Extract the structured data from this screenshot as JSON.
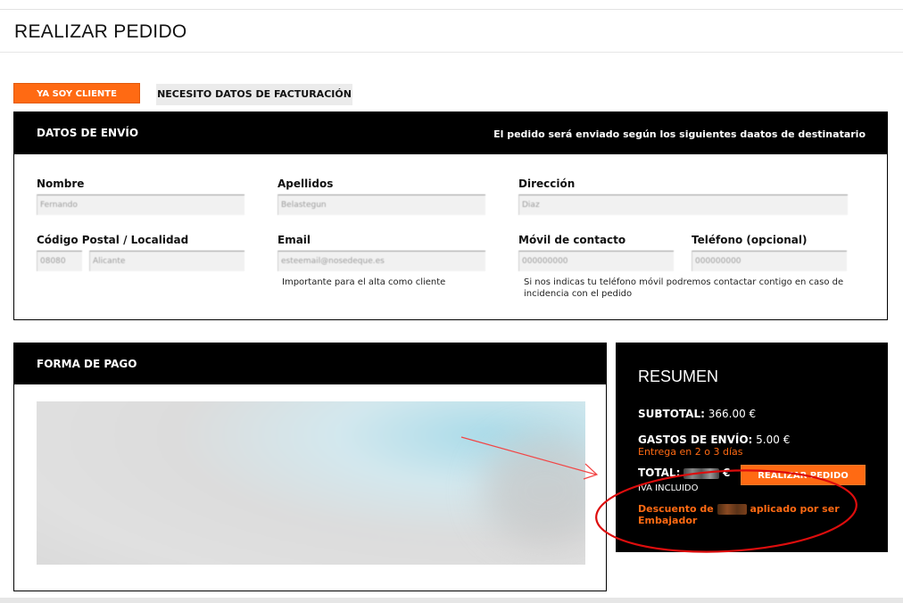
{
  "header": {
    "title": "REALIZAR PEDIDO"
  },
  "tabs": {
    "existing_customer": "YA SOY CLIENTE",
    "billing_data": "NECESITO DATOS DE FACTURACIÓN"
  },
  "shipping": {
    "heading": "DATOS DE ENVÍO",
    "note": "El pedido será enviado según los siguientes daatos de destinatario",
    "fields": {
      "nombre": {
        "label": "Nombre",
        "value": "Fernando"
      },
      "apellidos": {
        "label": "Apellidos",
        "value": "Belastegun"
      },
      "direccion": {
        "label": "Dirección",
        "value": "Diaz"
      },
      "codigo_postal": {
        "label": "Código Postal / Localidad",
        "value": "08080",
        "localidad": "Alicante"
      },
      "email": {
        "label": "Email",
        "value": "esteemail@nosedeque.es",
        "hint": "Importante para el alta como cliente"
      },
      "movil": {
        "label": "Móvil de contacto",
        "value": "000000000"
      },
      "telefono": {
        "label": "Teléfono (opcional)",
        "value": "000000000"
      },
      "phone_hint": "Si nos indicas tu teléfono móvil podremos contactar contigo en caso de incidencia con el pedido"
    }
  },
  "payment": {
    "heading": "FORMA DE PAGO"
  },
  "summary": {
    "title": "RESUMEN",
    "subtotal_label": "SUBTOTAL:",
    "subtotal_value": "366.00 €",
    "shipping_label": "GASTOS DE ENVÍO:",
    "shipping_value": "5.00 €",
    "delivery": "Entrega en 2 o 3 días",
    "total_label": "TOTAL:",
    "total_currency": "€",
    "vat": "IVA INCLUIDO",
    "order_button": "REALIZAR PEDIDO",
    "discount_prefix": "Descuento de",
    "discount_suffix": "aplicado por ser Embajador"
  },
  "colors": {
    "accent": "#ff6a13",
    "panel": "#000000",
    "annotation": "#e01010"
  }
}
